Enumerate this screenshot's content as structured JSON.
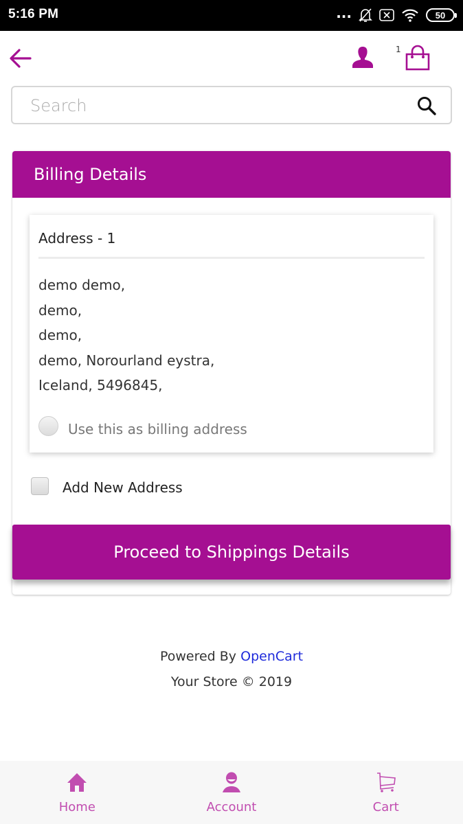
{
  "status_bar": {
    "time": "5:16 PM",
    "more_indicator": "...",
    "icons": [
      "bell-muted-icon",
      "sim-none-icon",
      "wifi-icon"
    ],
    "battery_level": "50"
  },
  "header": {
    "back_icon": "arrow-left-icon",
    "account_icon": "user-silhouette-icon",
    "cart_count": "1",
    "cart_icon": "shopping-bag-icon"
  },
  "search": {
    "placeholder": "Search",
    "value": "",
    "icon": "search-icon"
  },
  "billing": {
    "title": "Billing Details",
    "address_card": {
      "title": "Address - 1",
      "lines": [
        "demo demo,",
        "demo,",
        "demo,",
        "demo, Norourland eystra,",
        "Iceland, 5496845,"
      ],
      "radio_label": "Use this as billing address",
      "radio_checked": false
    },
    "add_new_label": "Add New Address",
    "add_new_checked": false,
    "proceed_label": "Proceed to Shippings Details"
  },
  "footer": {
    "powered_by": "Powered By",
    "powered_link": "OpenCart",
    "copyright": "Your Store © 2019"
  },
  "bottom_nav": {
    "items": [
      {
        "label": "Home",
        "icon": "home-icon"
      },
      {
        "label": "Account",
        "icon": "account-icon"
      },
      {
        "label": "Cart",
        "icon": "cart-icon"
      }
    ]
  },
  "colors": {
    "brand": "#a50f92",
    "nav_accent": "#c14db0",
    "link": "#1f2bdb"
  }
}
